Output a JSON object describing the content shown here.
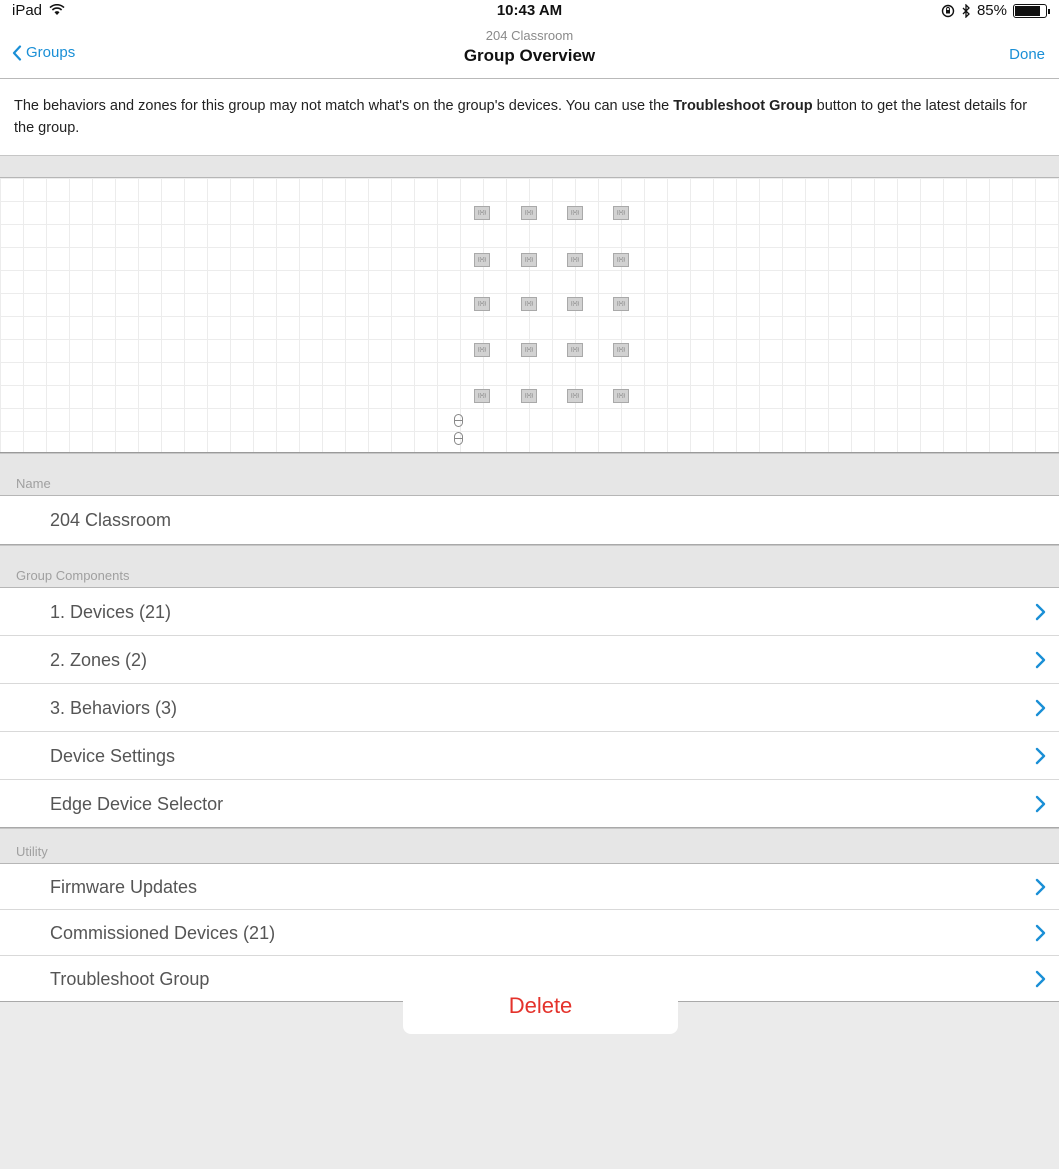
{
  "status_bar": {
    "device": "iPad",
    "time": "10:43 AM",
    "battery": "85%"
  },
  "nav": {
    "back_label": "Groups",
    "subtitle": "204 Classroom",
    "title": "Group Overview",
    "done_label": "Done"
  },
  "notice": {
    "text_before": "The behaviors and zones for this group may not match what's on the group's devices. You can use the ",
    "bold": "Troubleshoot Group",
    "text_after": " button to get the latest details for the group."
  },
  "name_section": {
    "header": "Name",
    "value": "204 Classroom"
  },
  "components_section": {
    "header": "Group Components",
    "items": [
      {
        "label": "1. Devices (21)"
      },
      {
        "label": "2. Zones (2)"
      },
      {
        "label": "3. Behaviors (3)"
      },
      {
        "label": "Device Settings"
      },
      {
        "label": "Edge Device Selector"
      }
    ]
  },
  "utility_section": {
    "header": "Utility",
    "items": [
      {
        "label": "Firmware Updates"
      },
      {
        "label": "Commissioned Devices (21)"
      },
      {
        "label": "Troubleshoot Group"
      }
    ]
  },
  "delete_label": "Delete",
  "colors": {
    "accent": "#1a8fd6",
    "destructive": "#e4322b",
    "background": "#ebebeb"
  },
  "icons": {
    "back": "chevron-left-icon",
    "row": "chevron-right-icon",
    "wifi": "wifi-icon",
    "bluetooth": "bluetooth-icon",
    "rotation_lock": "rotation-lock-icon",
    "battery": "battery-icon"
  }
}
